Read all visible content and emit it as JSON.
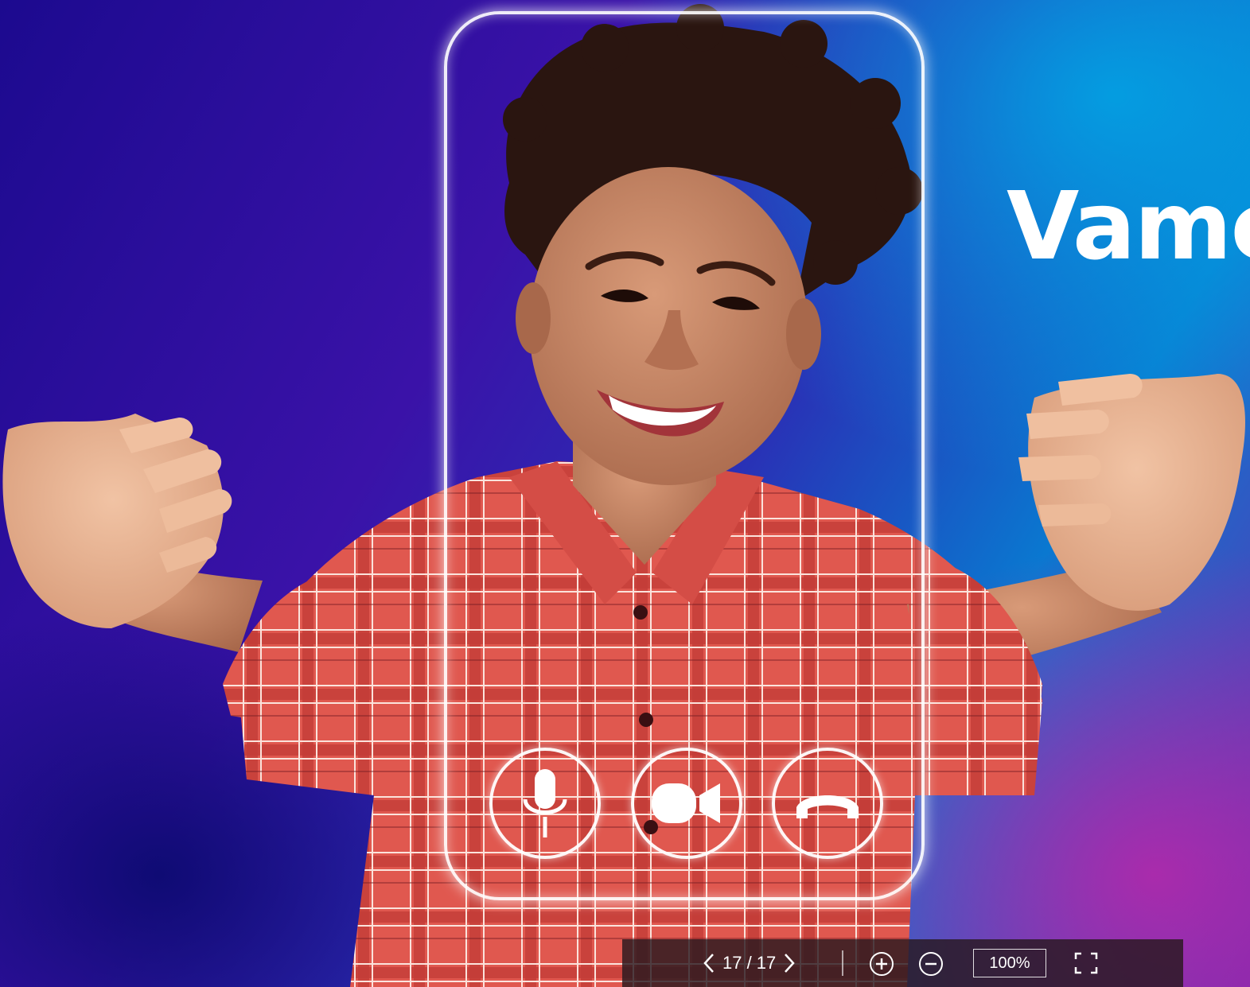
{
  "slide": {
    "title": "Vamc"
  },
  "call_controls": {
    "mic_icon": "microphone-icon",
    "video_icon": "video-camera-icon",
    "hangup_icon": "phone-hangup-icon"
  },
  "toolbar": {
    "page_indicator": "17 / 17",
    "current_page": 17,
    "total_pages": 17,
    "zoom_value": "100%",
    "icons": {
      "prev": "chevron-left-icon",
      "next": "chevron-right-icon",
      "zoom_in": "zoom-in-icon",
      "zoom_out": "zoom-out-icon",
      "fullscreen": "fullscreen-icon"
    }
  },
  "colors": {
    "bg_deep_blue": "#1c0a8f",
    "bg_cyan": "#0a78d0",
    "bg_magenta": "#b428aa",
    "shirt_red": "#e0584f",
    "skin": "#b9785a",
    "hair": "#2a1510",
    "toolbar_bg": "#28191e",
    "white": "#ffffff"
  }
}
